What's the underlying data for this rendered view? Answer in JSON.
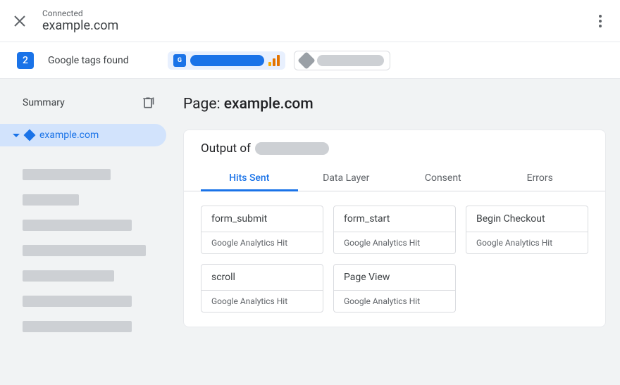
{
  "header": {
    "connected_label": "Connected",
    "domain": "example.com"
  },
  "tags_bar": {
    "count": "2",
    "found_text": "Google tags found"
  },
  "sidebar": {
    "summary_label": "Summary",
    "active_page": "example.com",
    "placeholder_widths": [
      125,
      80,
      155,
      175,
      130,
      155,
      155
    ]
  },
  "content": {
    "page_label": "Page: ",
    "page_name": "example.com",
    "output_label": "Output of",
    "tabs": [
      {
        "label": "Hits Sent",
        "active": true
      },
      {
        "label": "Data Layer",
        "active": false
      },
      {
        "label": "Consent",
        "active": false
      },
      {
        "label": "Errors",
        "active": false
      }
    ],
    "hits": [
      {
        "name": "form_submit",
        "type": "Google Analytics Hit"
      },
      {
        "name": "form_start",
        "type": "Google Analytics Hit"
      },
      {
        "name": "Begin Checkout",
        "type": "Google Analytics Hit"
      },
      {
        "name": "scroll",
        "type": "Google Analytics Hit"
      },
      {
        "name": "Page View",
        "type": "Google Analytics Hit"
      }
    ]
  }
}
